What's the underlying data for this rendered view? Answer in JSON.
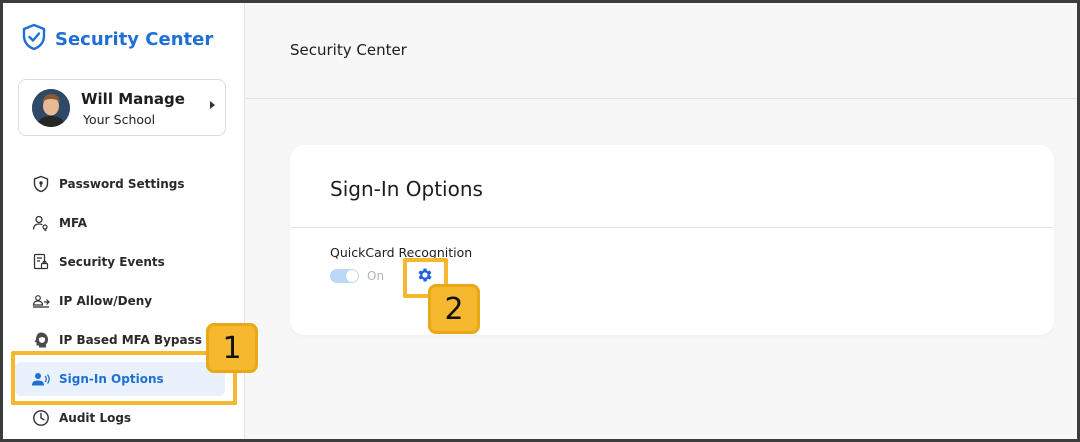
{
  "brand": {
    "title": "Security Center",
    "icon": "shield-check-icon",
    "color": "#1f6fd6"
  },
  "profile": {
    "name": "Will Manage",
    "org": "Your School"
  },
  "nav": {
    "items": [
      {
        "label": "Password Settings",
        "icon": "shield-lock-icon"
      },
      {
        "label": "MFA",
        "icon": "user-key-icon"
      },
      {
        "label": "Security Events",
        "icon": "document-lock-icon"
      },
      {
        "label": "IP Allow/Deny",
        "icon": "network-icon"
      },
      {
        "label": "IP Based MFA Bypass",
        "icon": "head-shield-icon"
      },
      {
        "label": "Sign-In Options",
        "icon": "user-signal-icon",
        "active": true
      },
      {
        "label": "Audit Logs",
        "icon": "clock-icon"
      }
    ]
  },
  "main": {
    "header_title": "Security Center",
    "card": {
      "title": "Sign-In Options",
      "setting_label": "QuickCard Recognition",
      "toggle_text": "On",
      "toggle_state": "on"
    }
  },
  "callouts": {
    "one": "1",
    "two": "2",
    "color": "#f5b82e"
  }
}
